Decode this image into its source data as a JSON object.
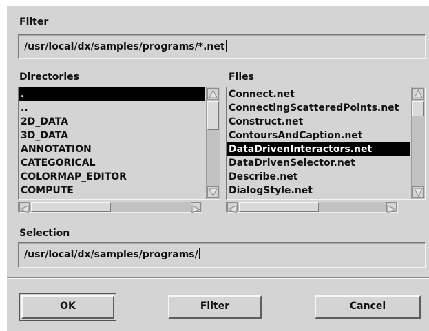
{
  "filter": {
    "label": "Filter",
    "value": "/usr/local/dx/samples/programs/*.net"
  },
  "directories": {
    "label": "Directories",
    "items": [
      ".",
      "..",
      "2D_DATA",
      "3D_DATA",
      "ANNOTATION",
      "CATEGORICAL",
      "COLORMAP_EDITOR",
      "COMPUTE"
    ],
    "selected_index": 0
  },
  "files": {
    "label": "Files",
    "items": [
      "Connect.net",
      "ConnectingScatteredPoints.net",
      "Construct.net",
      "ContoursAndCaption.net",
      "DataDrivenInteractors.net",
      "DataDrivenSelector.net",
      "Describe.net",
      "DialogStyle.net"
    ],
    "selected_index": 4
  },
  "selection": {
    "label": "Selection",
    "value": "/usr/local/dx/samples/programs/"
  },
  "buttons": {
    "ok": "OK",
    "filter": "Filter",
    "cancel": "Cancel"
  },
  "icons": {
    "up": "scroll-up-arrow-icon",
    "down": "scroll-down-arrow-icon",
    "left": "scroll-left-arrow-icon",
    "right": "scroll-right-arrow-icon"
  },
  "colors": {
    "background": "#d4d4d4",
    "selection_bg": "#000000",
    "selection_fg": "#ffffff"
  }
}
